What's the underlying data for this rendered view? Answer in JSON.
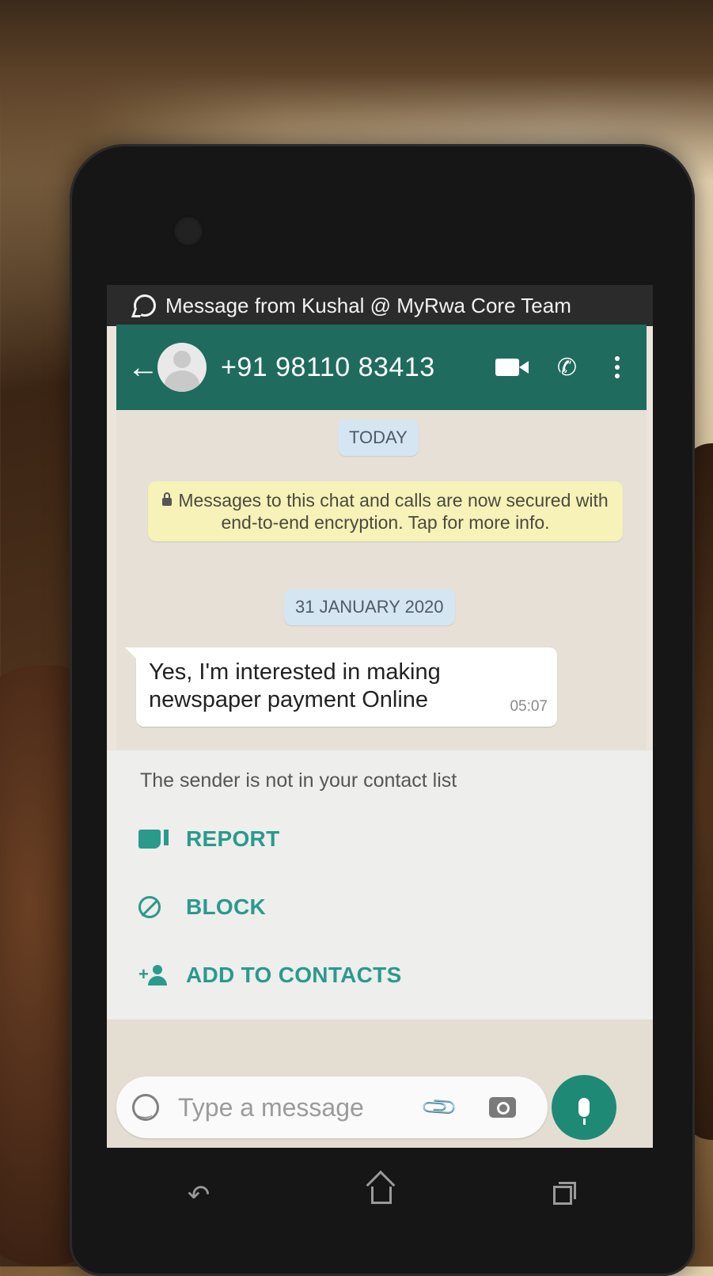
{
  "notification": {
    "text": "Message from Kushal @ MyRwa Core Team",
    "icon": "whatsapp-icon"
  },
  "header": {
    "contact": "+91 98110 83413",
    "icons": [
      "back-arrow-icon",
      "avatar",
      "video-call-icon",
      "voice-call-icon",
      "more-menu-icon"
    ],
    "color": "#1f6b5e"
  },
  "chat": {
    "today_label": "TODAY",
    "encryption_notice": "Messages to this chat and calls are now secured with end-to-end encryption. Tap for more info.",
    "date_label": "31 JANUARY 2020",
    "messages": [
      {
        "text": "Yes, I'm interested in making newspaper payment Online",
        "time": "05:07"
      }
    ]
  },
  "unknown_sender": {
    "notice": "The sender is not in your contact list",
    "actions": [
      {
        "label": "REPORT",
        "icon": "thumbs-down-icon"
      },
      {
        "label": "BLOCK",
        "icon": "block-icon"
      },
      {
        "label": "ADD TO CONTACTS",
        "icon": "add-person-icon"
      }
    ],
    "accent": "#2a9a8d"
  },
  "composer": {
    "placeholder": "Type a message",
    "icons": [
      "emoji-icon",
      "attach-icon",
      "camera-icon",
      "mic-icon"
    ]
  },
  "system_nav": [
    "nav-back-icon",
    "nav-home-icon",
    "nav-recent-icon"
  ]
}
